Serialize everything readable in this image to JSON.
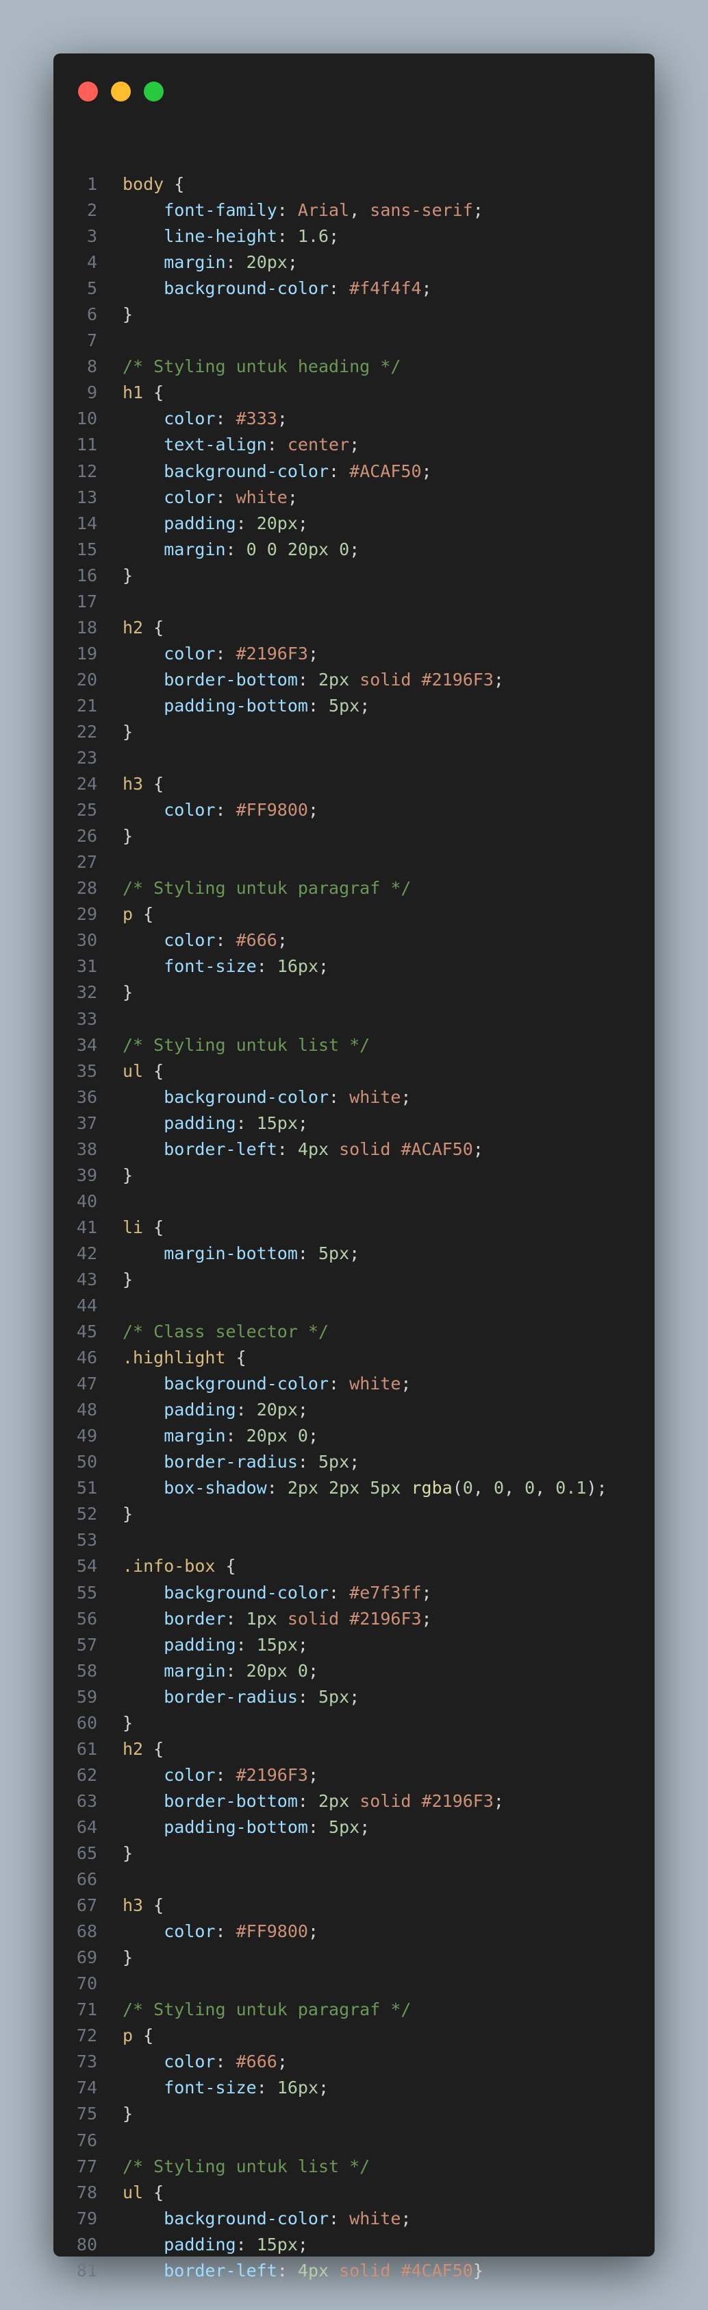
{
  "window": {
    "controls": [
      {
        "name": "close",
        "color": "#ff5f56"
      },
      {
        "name": "minimize",
        "color": "#ffbd2e"
      },
      {
        "name": "zoom",
        "color": "#27c93f"
      }
    ]
  },
  "code_lines": [
    [
      [
        "sel",
        "body"
      ],
      [
        "pun",
        " {"
      ]
    ],
    [
      [
        "pun",
        "    "
      ],
      [
        "prop",
        "font-family"
      ],
      [
        "pun",
        ": "
      ],
      [
        "val",
        "Arial"
      ],
      [
        "pun",
        ", "
      ],
      [
        "val",
        "sans-serif"
      ],
      [
        "pun",
        ";"
      ]
    ],
    [
      [
        "pun",
        "    "
      ],
      [
        "prop",
        "line-height"
      ],
      [
        "pun",
        ": "
      ],
      [
        "num",
        "1.6"
      ],
      [
        "pun",
        ";"
      ]
    ],
    [
      [
        "pun",
        "    "
      ],
      [
        "prop",
        "margin"
      ],
      [
        "pun",
        ": "
      ],
      [
        "num",
        "20px"
      ],
      [
        "pun",
        ";"
      ]
    ],
    [
      [
        "pun",
        "    "
      ],
      [
        "prop",
        "background-color"
      ],
      [
        "pun",
        ": "
      ],
      [
        "val",
        "#f4f4f4"
      ],
      [
        "pun",
        ";"
      ]
    ],
    [
      [
        "pun",
        "}"
      ]
    ],
    [],
    [
      [
        "com",
        "/* Styling untuk heading */"
      ]
    ],
    [
      [
        "sel",
        "h1"
      ],
      [
        "pun",
        " {"
      ]
    ],
    [
      [
        "pun",
        "    "
      ],
      [
        "prop",
        "color"
      ],
      [
        "pun",
        ": "
      ],
      [
        "val",
        "#333"
      ],
      [
        "pun",
        ";"
      ]
    ],
    [
      [
        "pun",
        "    "
      ],
      [
        "prop",
        "text-align"
      ],
      [
        "pun",
        ": "
      ],
      [
        "val",
        "center"
      ],
      [
        "pun",
        ";"
      ]
    ],
    [
      [
        "pun",
        "    "
      ],
      [
        "prop",
        "background-color"
      ],
      [
        "pun",
        ": "
      ],
      [
        "val",
        "#ACAF50"
      ],
      [
        "pun",
        ";"
      ]
    ],
    [
      [
        "pun",
        "    "
      ],
      [
        "prop",
        "color"
      ],
      [
        "pun",
        ": "
      ],
      [
        "val",
        "white"
      ],
      [
        "pun",
        ";"
      ]
    ],
    [
      [
        "pun",
        "    "
      ],
      [
        "prop",
        "padding"
      ],
      [
        "pun",
        ": "
      ],
      [
        "num",
        "20px"
      ],
      [
        "pun",
        ";"
      ]
    ],
    [
      [
        "pun",
        "    "
      ],
      [
        "prop",
        "margin"
      ],
      [
        "pun",
        ": "
      ],
      [
        "num",
        "0 0 20px 0"
      ],
      [
        "pun",
        ";"
      ]
    ],
    [
      [
        "pun",
        "}"
      ]
    ],
    [],
    [
      [
        "sel",
        "h2"
      ],
      [
        "pun",
        " {"
      ]
    ],
    [
      [
        "pun",
        "    "
      ],
      [
        "prop",
        "color"
      ],
      [
        "pun",
        ": "
      ],
      [
        "val",
        "#2196F3"
      ],
      [
        "pun",
        ";"
      ]
    ],
    [
      [
        "pun",
        "    "
      ],
      [
        "prop",
        "border-bottom"
      ],
      [
        "pun",
        ": "
      ],
      [
        "num",
        "2px"
      ],
      [
        "pun",
        " "
      ],
      [
        "val",
        "solid"
      ],
      [
        "pun",
        " "
      ],
      [
        "val",
        "#2196F3"
      ],
      [
        "pun",
        ";"
      ]
    ],
    [
      [
        "pun",
        "    "
      ],
      [
        "prop",
        "padding-bottom"
      ],
      [
        "pun",
        ": "
      ],
      [
        "num",
        "5px"
      ],
      [
        "pun",
        ";"
      ]
    ],
    [
      [
        "pun",
        "}"
      ]
    ],
    [],
    [
      [
        "sel",
        "h3"
      ],
      [
        "pun",
        " {"
      ]
    ],
    [
      [
        "pun",
        "    "
      ],
      [
        "prop",
        "color"
      ],
      [
        "pun",
        ": "
      ],
      [
        "val",
        "#FF9800"
      ],
      [
        "pun",
        ";"
      ]
    ],
    [
      [
        "pun",
        "}"
      ]
    ],
    [],
    [
      [
        "com",
        "/* Styling untuk paragraf */"
      ]
    ],
    [
      [
        "sel",
        "p"
      ],
      [
        "pun",
        " {"
      ]
    ],
    [
      [
        "pun",
        "    "
      ],
      [
        "prop",
        "color"
      ],
      [
        "pun",
        ": "
      ],
      [
        "val",
        "#666"
      ],
      [
        "pun",
        ";"
      ]
    ],
    [
      [
        "pun",
        "    "
      ],
      [
        "prop",
        "font-size"
      ],
      [
        "pun",
        ": "
      ],
      [
        "num",
        "16px"
      ],
      [
        "pun",
        ";"
      ]
    ],
    [
      [
        "pun",
        "}"
      ]
    ],
    [],
    [
      [
        "com",
        "/* Styling untuk list */"
      ]
    ],
    [
      [
        "sel",
        "ul"
      ],
      [
        "pun",
        " {"
      ]
    ],
    [
      [
        "pun",
        "    "
      ],
      [
        "prop",
        "background-color"
      ],
      [
        "pun",
        ": "
      ],
      [
        "val",
        "white"
      ],
      [
        "pun",
        ";"
      ]
    ],
    [
      [
        "pun",
        "    "
      ],
      [
        "prop",
        "padding"
      ],
      [
        "pun",
        ": "
      ],
      [
        "num",
        "15px"
      ],
      [
        "pun",
        ";"
      ]
    ],
    [
      [
        "pun",
        "    "
      ],
      [
        "prop",
        "border-left"
      ],
      [
        "pun",
        ": "
      ],
      [
        "num",
        "4px"
      ],
      [
        "pun",
        " "
      ],
      [
        "val",
        "solid"
      ],
      [
        "pun",
        " "
      ],
      [
        "val",
        "#ACAF50"
      ],
      [
        "pun",
        ";"
      ]
    ],
    [
      [
        "pun",
        "}"
      ]
    ],
    [],
    [
      [
        "sel",
        "li"
      ],
      [
        "pun",
        " {"
      ]
    ],
    [
      [
        "pun",
        "    "
      ],
      [
        "prop",
        "margin-bottom"
      ],
      [
        "pun",
        ": "
      ],
      [
        "num",
        "5px"
      ],
      [
        "pun",
        ";"
      ]
    ],
    [
      [
        "pun",
        "}"
      ]
    ],
    [],
    [
      [
        "com",
        "/* Class selector */"
      ]
    ],
    [
      [
        "sel",
        ".highlight"
      ],
      [
        "pun",
        " {"
      ]
    ],
    [
      [
        "pun",
        "    "
      ],
      [
        "prop",
        "background-color"
      ],
      [
        "pun",
        ": "
      ],
      [
        "val",
        "white"
      ],
      [
        "pun",
        ";"
      ]
    ],
    [
      [
        "pun",
        "    "
      ],
      [
        "prop",
        "padding"
      ],
      [
        "pun",
        ": "
      ],
      [
        "num",
        "20px"
      ],
      [
        "pun",
        ";"
      ]
    ],
    [
      [
        "pun",
        "    "
      ],
      [
        "prop",
        "margin"
      ],
      [
        "pun",
        ": "
      ],
      [
        "num",
        "20px 0"
      ],
      [
        "pun",
        ";"
      ]
    ],
    [
      [
        "pun",
        "    "
      ],
      [
        "prop",
        "border-radius"
      ],
      [
        "pun",
        ": "
      ],
      [
        "num",
        "5px"
      ],
      [
        "pun",
        ";"
      ]
    ],
    [
      [
        "pun",
        "    "
      ],
      [
        "prop",
        "box-shadow"
      ],
      [
        "pun",
        ": "
      ],
      [
        "num",
        "2px 2px 5px"
      ],
      [
        "pun",
        " "
      ],
      [
        "fn",
        "rgba"
      ],
      [
        "pun",
        "("
      ],
      [
        "num",
        "0"
      ],
      [
        "pun",
        ", "
      ],
      [
        "num",
        "0"
      ],
      [
        "pun",
        ", "
      ],
      [
        "num",
        "0"
      ],
      [
        "pun",
        ", "
      ],
      [
        "num",
        "0.1"
      ],
      [
        "pun",
        ");"
      ]
    ],
    [
      [
        "pun",
        "}"
      ]
    ],
    [],
    [
      [
        "sel",
        ".info-box"
      ],
      [
        "pun",
        " {"
      ]
    ],
    [
      [
        "pun",
        "    "
      ],
      [
        "prop",
        "background-color"
      ],
      [
        "pun",
        ": "
      ],
      [
        "val",
        "#e7f3ff"
      ],
      [
        "pun",
        ";"
      ]
    ],
    [
      [
        "pun",
        "    "
      ],
      [
        "prop",
        "border"
      ],
      [
        "pun",
        ": "
      ],
      [
        "num",
        "1px"
      ],
      [
        "pun",
        " "
      ],
      [
        "val",
        "solid"
      ],
      [
        "pun",
        " "
      ],
      [
        "val",
        "#2196F3"
      ],
      [
        "pun",
        ";"
      ]
    ],
    [
      [
        "pun",
        "    "
      ],
      [
        "prop",
        "padding"
      ],
      [
        "pun",
        ": "
      ],
      [
        "num",
        "15px"
      ],
      [
        "pun",
        ";"
      ]
    ],
    [
      [
        "pun",
        "    "
      ],
      [
        "prop",
        "margin"
      ],
      [
        "pun",
        ": "
      ],
      [
        "num",
        "20px 0"
      ],
      [
        "pun",
        ";"
      ]
    ],
    [
      [
        "pun",
        "    "
      ],
      [
        "prop",
        "border-radius"
      ],
      [
        "pun",
        ": "
      ],
      [
        "num",
        "5px"
      ],
      [
        "pun",
        ";"
      ]
    ],
    [
      [
        "pun",
        "}"
      ]
    ],
    [
      [
        "sel",
        "h2"
      ],
      [
        "pun",
        " {"
      ]
    ],
    [
      [
        "pun",
        "    "
      ],
      [
        "prop",
        "color"
      ],
      [
        "pun",
        ": "
      ],
      [
        "val",
        "#2196F3"
      ],
      [
        "pun",
        ";"
      ]
    ],
    [
      [
        "pun",
        "    "
      ],
      [
        "prop",
        "border-bottom"
      ],
      [
        "pun",
        ": "
      ],
      [
        "num",
        "2px"
      ],
      [
        "pun",
        " "
      ],
      [
        "val",
        "solid"
      ],
      [
        "pun",
        " "
      ],
      [
        "val",
        "#2196F3"
      ],
      [
        "pun",
        ";"
      ]
    ],
    [
      [
        "pun",
        "    "
      ],
      [
        "prop",
        "padding-bottom"
      ],
      [
        "pun",
        ": "
      ],
      [
        "num",
        "5px"
      ],
      [
        "pun",
        ";"
      ]
    ],
    [
      [
        "pun",
        "}"
      ]
    ],
    [],
    [
      [
        "sel",
        "h3"
      ],
      [
        "pun",
        " {"
      ]
    ],
    [
      [
        "pun",
        "    "
      ],
      [
        "prop",
        "color"
      ],
      [
        "pun",
        ": "
      ],
      [
        "val",
        "#FF9800"
      ],
      [
        "pun",
        ";"
      ]
    ],
    [
      [
        "pun",
        "}"
      ]
    ],
    [],
    [
      [
        "com",
        "/* Styling untuk paragraf */"
      ]
    ],
    [
      [
        "sel",
        "p"
      ],
      [
        "pun",
        " {"
      ]
    ],
    [
      [
        "pun",
        "    "
      ],
      [
        "prop",
        "color"
      ],
      [
        "pun",
        ": "
      ],
      [
        "val",
        "#666"
      ],
      [
        "pun",
        ";"
      ]
    ],
    [
      [
        "pun",
        "    "
      ],
      [
        "prop",
        "font-size"
      ],
      [
        "pun",
        ": "
      ],
      [
        "num",
        "16px"
      ],
      [
        "pun",
        ";"
      ]
    ],
    [
      [
        "pun",
        "}"
      ]
    ],
    [],
    [
      [
        "com",
        "/* Styling untuk list */"
      ]
    ],
    [
      [
        "sel",
        "ul"
      ],
      [
        "pun",
        " {"
      ]
    ],
    [
      [
        "pun",
        "    "
      ],
      [
        "prop",
        "background-color"
      ],
      [
        "pun",
        ": "
      ],
      [
        "val",
        "white"
      ],
      [
        "pun",
        ";"
      ]
    ],
    [
      [
        "pun",
        "    "
      ],
      [
        "prop",
        "padding"
      ],
      [
        "pun",
        ": "
      ],
      [
        "num",
        "15px"
      ],
      [
        "pun",
        ";"
      ]
    ],
    [
      [
        "pun",
        "    "
      ],
      [
        "prop",
        "border-left"
      ],
      [
        "pun",
        ": "
      ],
      [
        "num",
        "4px"
      ],
      [
        "pun",
        " "
      ],
      [
        "val",
        "solid"
      ],
      [
        "pun",
        " "
      ],
      [
        "val",
        "#4CAF50"
      ],
      [
        "pun",
        "}"
      ]
    ]
  ]
}
